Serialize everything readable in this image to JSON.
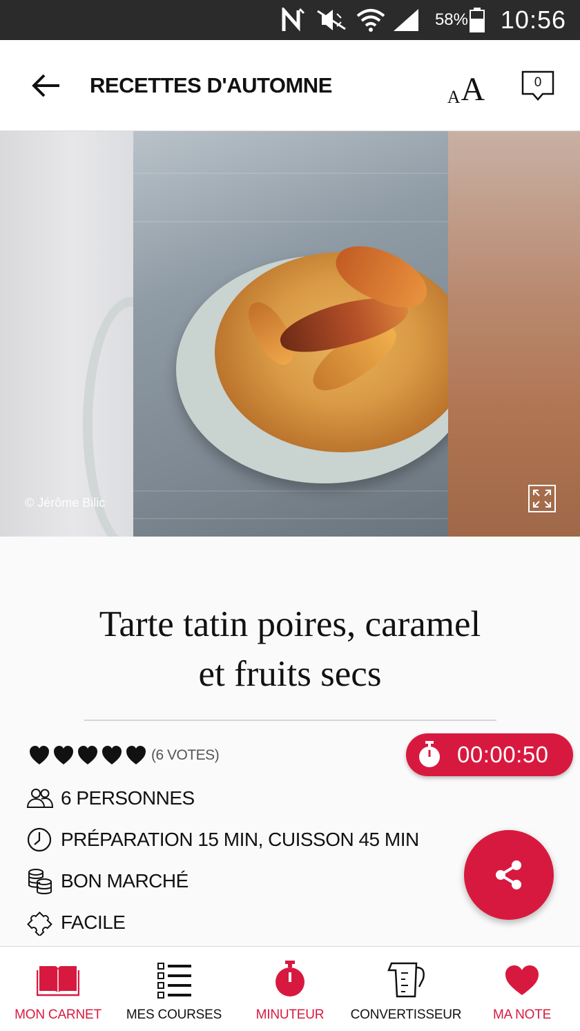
{
  "status_bar": {
    "battery_percent": "58%",
    "time": "10:56"
  },
  "toolbar": {
    "title": "RECETTES D'AUTOMNE",
    "font_size_small": "A",
    "font_size_large": "A",
    "comment_count": "0"
  },
  "hero": {
    "photo_credit": "© Jérôme Bilic"
  },
  "recipe": {
    "title_line1": "Tarte tatin poires, caramel",
    "title_line2": "et fruits secs",
    "rating_hearts": 5,
    "votes": "(6 VOTES)",
    "timer": "00:00:50",
    "servings": "6 PERSONNES",
    "time": "PRÉPARATION 15 MIN, CUISSON 45 MIN",
    "cost": "BON MARCHÉ",
    "difficulty": "FACILE"
  },
  "bottom_nav": {
    "items": [
      {
        "label": "MON CARNET",
        "icon": "book-icon",
        "active": true
      },
      {
        "label": "MES COURSES",
        "icon": "list-icon",
        "active": false
      },
      {
        "label": "MINUTEUR",
        "icon": "stopwatch-icon",
        "active": true
      },
      {
        "label": "CONVERTISSEUR",
        "icon": "measuring-cup-icon",
        "active": false
      },
      {
        "label": "MA NOTE",
        "icon": "heart-icon",
        "active": true
      }
    ]
  },
  "colors": {
    "accent": "#d8193f",
    "status_bar_bg": "#2b2b2b",
    "text": "#111111"
  }
}
